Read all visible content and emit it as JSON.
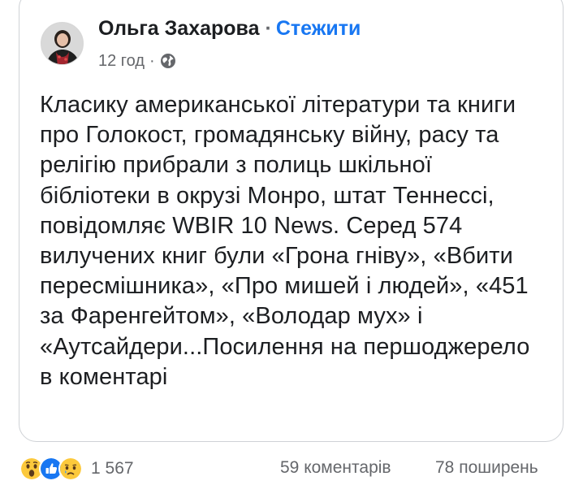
{
  "post": {
    "author": "Ольга Захарова",
    "separator": "·",
    "follow_label": "Стежити",
    "time": "12 год",
    "meta_separator": "·",
    "audience_icon": "globe-icon",
    "text": "Класику американської літератури та книги про Голокост, громадянську війну, расу та релігію прибрали з полиць шкільної бібліотеки в окрузі Монро, штат Теннессі, повідомляє WBIR 10 News. Серед 574 вилучених книг були «Грона гніву», «Вбити пересмішника», «Про мишей і людей», «451 за Фаренгейтом», «Володар мух» і «Аутсайдери...Посилення на першоджерело в коментарі"
  },
  "footer": {
    "reactions": [
      "wow-icon",
      "like-icon",
      "sad-icon"
    ],
    "reaction_count": "1 567",
    "comments": "59 коментарів",
    "shares": "78 поширень"
  },
  "colors": {
    "text": "#1c1e21",
    "secondary": "#65676b",
    "link": "#1877f2",
    "border": "#cfd2d6",
    "like_blue": "#1877f2",
    "emoji_yellow": "#fcc93c"
  }
}
